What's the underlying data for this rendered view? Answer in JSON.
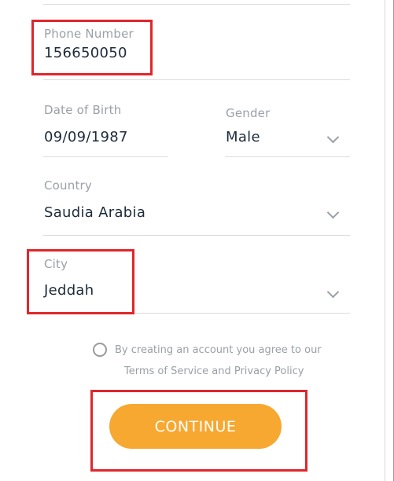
{
  "form": {
    "phone": {
      "label": "Phone Number",
      "value": "156650050"
    },
    "dob": {
      "label": "Date of Birth",
      "value": "09/09/1987"
    },
    "gender": {
      "label": "Gender",
      "value": "Male"
    },
    "country": {
      "label": "Country",
      "value": "Saudia Arabia"
    },
    "city": {
      "label": "City",
      "value": "Jeddah"
    }
  },
  "consent": {
    "line1": "By creating an account you agree to our",
    "line2": "Terms of Service and Privacy Policy"
  },
  "actions": {
    "continue_label": "CONTINUE"
  },
  "colors": {
    "highlight": "#e0262b",
    "button": "#f7a831",
    "label": "#9aa0a6",
    "value": "#1d2b3a"
  }
}
